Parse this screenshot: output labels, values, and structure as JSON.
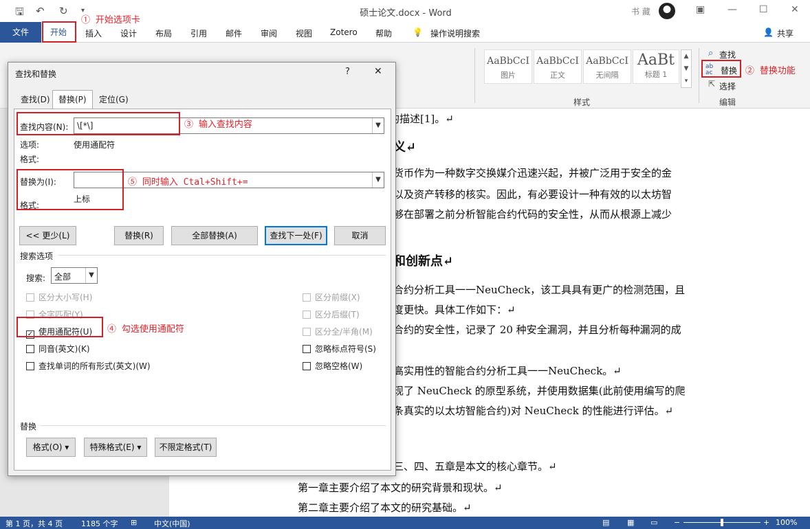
{
  "window": {
    "title": "硕士论文.docx  -  Word",
    "user": "书 藏"
  },
  "ribbon_tabs": [
    "文件",
    "开始",
    "插入",
    "设计",
    "布局",
    "引用",
    "邮件",
    "审阅",
    "视图",
    "Zotero",
    "帮助",
    "操作说明搜索"
  ],
  "share_label": "共享",
  "styles": [
    {
      "preview": "AaBbCcI",
      "name": "图片"
    },
    {
      "preview": "AaBbCcI",
      "name": "正文"
    },
    {
      "preview": "AaBbCcI",
      "name": "无间隔"
    },
    {
      "preview": "AaBt",
      "name": "标题 1"
    }
  ],
  "ribbon_groups": {
    "styles": "样式",
    "editing": "编辑"
  },
  "editing": {
    "find": "查找",
    "replace": "替换",
    "select": "选择"
  },
  "annotations": {
    "a1": "① 开始选项卡",
    "a2": "② 替换功能",
    "a3": "③ 输入查找内容",
    "a4": "④ 勾选使用通配符",
    "a5": "⑤ 同时输入 Ctal+Shift+="
  },
  "dialog": {
    "title": "查找和替换",
    "help": "?",
    "close": "✕",
    "tabs": [
      "查找(D)",
      "替换(P)",
      "定位(G)"
    ],
    "find_label": "查找内容(N):",
    "find_value": "\\[*\\]",
    "options_label": "选项:",
    "options_value": "使用通配符",
    "format_label": "格式:",
    "replace_label": "替换为(I):",
    "replace_value": "",
    "replace_format_label": "格式:",
    "replace_format_value": "上标",
    "buttons": {
      "less": "<< 更少(L)",
      "replace": "替换(R)",
      "replace_all": "全部替换(A)",
      "find_next": "查找下一处(F)",
      "cancel": "取消"
    },
    "search_options_title": "搜索选项",
    "search_label": "搜索:",
    "search_value": "全部",
    "left_checkboxes": [
      {
        "label": "区分大小写(H)",
        "checked": false,
        "disabled": true
      },
      {
        "label": "全字匹配(Y)",
        "checked": false,
        "disabled": true
      },
      {
        "label": "使用通配符(U)",
        "checked": true,
        "disabled": false
      },
      {
        "label": "同音(英文)(K)",
        "checked": false,
        "disabled": false
      },
      {
        "label": "查找单词的所有形式(英文)(W)",
        "checked": false,
        "disabled": false
      }
    ],
    "right_checkboxes": [
      {
        "label": "区分前缀(X)",
        "checked": false,
        "disabled": true
      },
      {
        "label": "区分后缀(T)",
        "checked": false,
        "disabled": true
      },
      {
        "label": "区分全/半角(M)",
        "checked": false,
        "disabled": true
      },
      {
        "label": "忽略标点符号(S)",
        "checked": false,
        "disabled": false
      },
      {
        "label": "忽略空格(W)",
        "checked": false,
        "disabled": false
      }
    ],
    "replace_section_title": "替换",
    "bottom_buttons": {
      "format": "格式(O) ▾",
      "special": "特殊格式(E) ▾",
      "no_format": "不限定格式(T)"
    }
  },
  "document_lines": [
    "的描述[1]。↵",
    "义↵",
    "货币作为一种数字交换媒介迅速兴起，并被广泛用于安全的金",
    "以及资产转移的核实。因此，有必要设计一种有效的以太坊智",
    "够在部署之前分析智能合约代码的安全性，从而从根源上减少",
    "和创新点↵",
    "合约分析工具一一NeuCheck，该工具具有更广的检测范围，且",
    "度更快。具体工作如下：↵",
    "合约的安全性，记录了 20 种安全漏洞，并且分析每种漏洞的成",
    "高实用性的智能合约分析工具一一NeuCheck。↵",
    "现了 NeuCheck 的原型系统，并使用数据集(此前使用编写的爬",
    "条真实的以太坊智能合约)对 NeuCheck 的性能进行评估。↵",
    "三、四、五章是本文的核心章节。↵",
    "第一章主要介绍了本文的研究背景和现状。↵",
    "第二章主要介绍了本文的研究基础。↵"
  ],
  "status": {
    "page": "第 1 页，共 4 页",
    "words": "1185 个字",
    "lang": "中文(中国)",
    "zoom": "100%"
  }
}
